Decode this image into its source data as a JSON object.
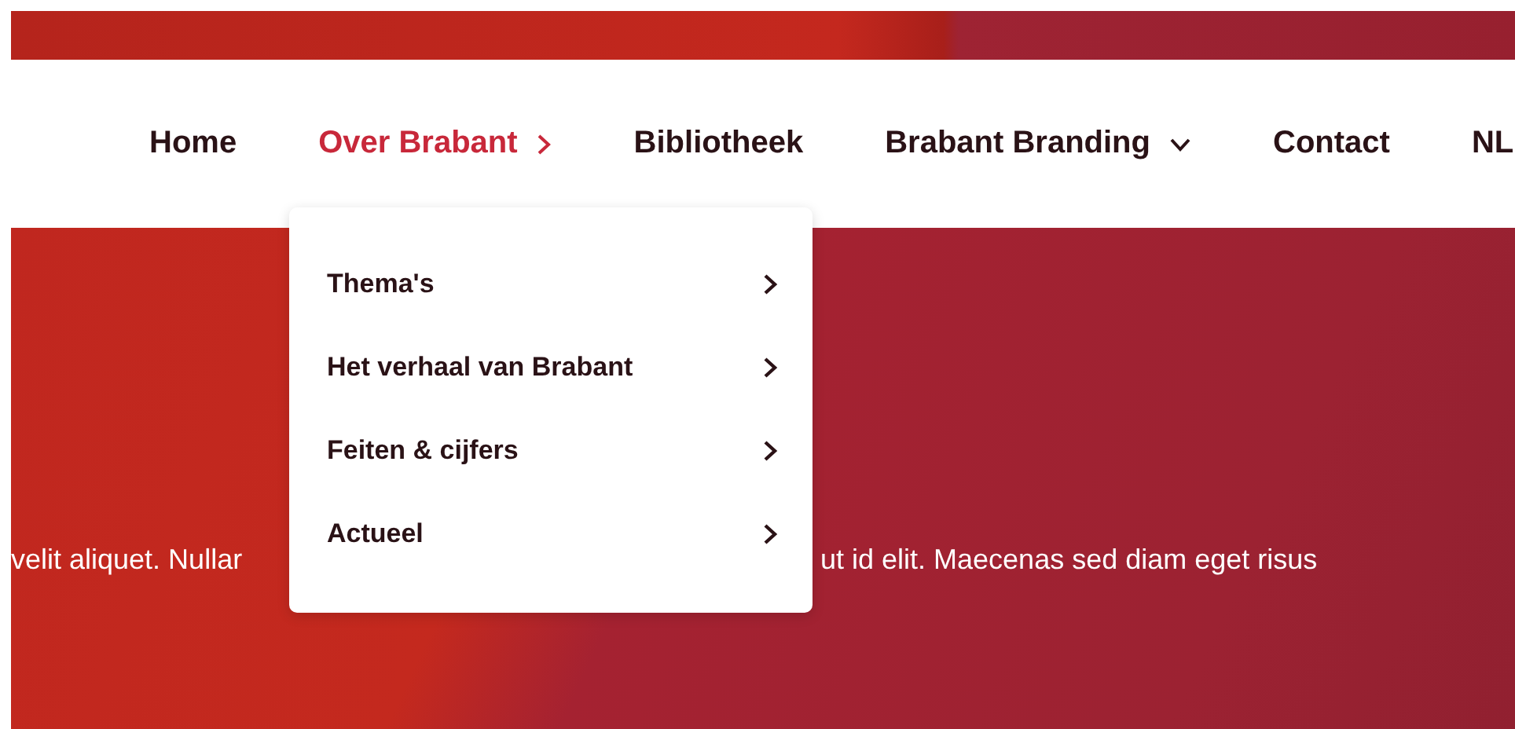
{
  "nav": {
    "items": [
      {
        "label": "Home",
        "selected": false,
        "kind": "link"
      },
      {
        "label": "Over Brabant",
        "selected": true,
        "kind": "submenu"
      },
      {
        "label": "Bibliotheek",
        "selected": false,
        "kind": "link"
      },
      {
        "label": "Brabant Branding",
        "selected": false,
        "kind": "dropdown"
      },
      {
        "label": "Contact",
        "selected": false,
        "kind": "link"
      },
      {
        "label": "NL",
        "selected": false,
        "kind": "link"
      }
    ]
  },
  "dropdown": {
    "items": [
      {
        "label": "Thema's",
        "kind": "submenu"
      },
      {
        "label": "Het verhaal van Brabant",
        "kind": "submenu"
      },
      {
        "label": "Feiten & cijfers",
        "kind": "submenu"
      },
      {
        "label": "Actueel",
        "kind": "submenu"
      }
    ]
  },
  "hero": {
    "text_left": "velit aliquet. Nullar",
    "text_right": "ut id elit. Maecenas sed diam eget risus"
  }
}
